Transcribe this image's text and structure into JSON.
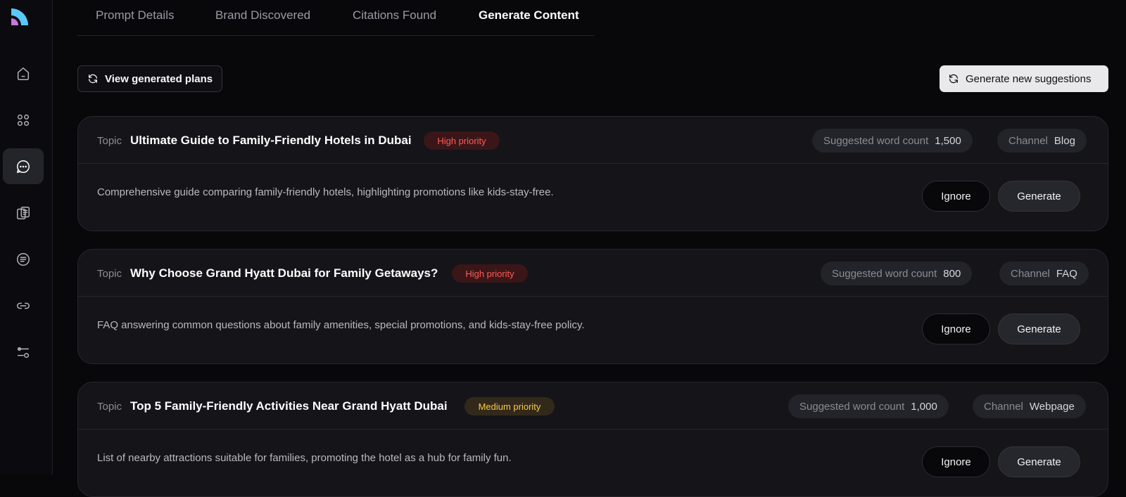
{
  "tabs": [
    {
      "label": "Prompt Details"
    },
    {
      "label": "Brand Discovered"
    },
    {
      "label": "Citations Found"
    },
    {
      "label": "Generate Content"
    }
  ],
  "active_tab": "Generate Content",
  "actions": {
    "view_plans_label": "View generated plans",
    "generate_new_label": "Generate new suggestions"
  },
  "sidebar": {
    "icons": [
      "home-icon",
      "grid-icon",
      "chat-icon",
      "documents-icon",
      "notes-icon",
      "link-icon",
      "settings-icon"
    ],
    "active": "chat-icon"
  },
  "colors": {
    "background": "#08080b",
    "card": "#141419",
    "high_priority": "#ff5b5b",
    "medium_priority": "#f7c948"
  },
  "cards": [
    {
      "topic_label": "Topic",
      "title": "Ultimate Guide to Family-Friendly Hotels in Dubai",
      "priority": "High priority",
      "word_count_label": "Suggested word count",
      "word_count": "1,500",
      "channel_label": "Channel",
      "channel": "Blog",
      "description": "Comprehensive guide comparing family-friendly hotels, highlighting promotions like kids-stay-free.",
      "ignore_label": "Ignore",
      "generate_label": "Generate"
    },
    {
      "topic_label": "Topic",
      "title": "Why Choose Grand Hyatt Dubai for Family Getaways?",
      "priority": "High priority",
      "word_count_label": "Suggested word count",
      "word_count": "800",
      "channel_label": "Channel",
      "channel": "FAQ",
      "description": "FAQ answering common questions about family amenities, special promotions, and kids-stay-free policy.",
      "ignore_label": "Ignore",
      "generate_label": "Generate"
    },
    {
      "topic_label": "Topic",
      "title": "Top 5 Family-Friendly Activities Near Grand Hyatt Dubai",
      "priority": "Medium priority",
      "word_count_label": "Suggested word count",
      "word_count": "1,000",
      "channel_label": "Channel",
      "channel": "Webpage",
      "description": "List of nearby attractions suitable for families, promoting the hotel as a hub for family fun.",
      "ignore_label": "Ignore",
      "generate_label": "Generate"
    }
  ]
}
